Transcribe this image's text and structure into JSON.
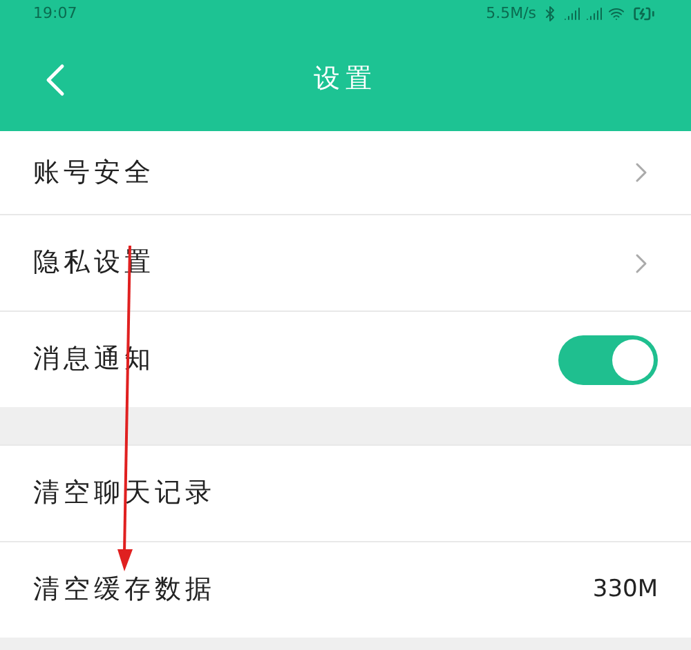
{
  "status_bar": {
    "time": "19:07",
    "speed": "5.5M/s"
  },
  "header": {
    "title": "设置"
  },
  "groups": [
    {
      "items": [
        {
          "kind": "link",
          "label": "账号安全"
        },
        {
          "kind": "link",
          "label": "隐私设置"
        },
        {
          "kind": "toggle",
          "label": "消息通知",
          "on": true
        }
      ]
    },
    {
      "items": [
        {
          "kind": "plain",
          "label": "清空聊天记录"
        },
        {
          "kind": "value",
          "label": "清空缓存数据",
          "value": "330M"
        }
      ]
    }
  ]
}
